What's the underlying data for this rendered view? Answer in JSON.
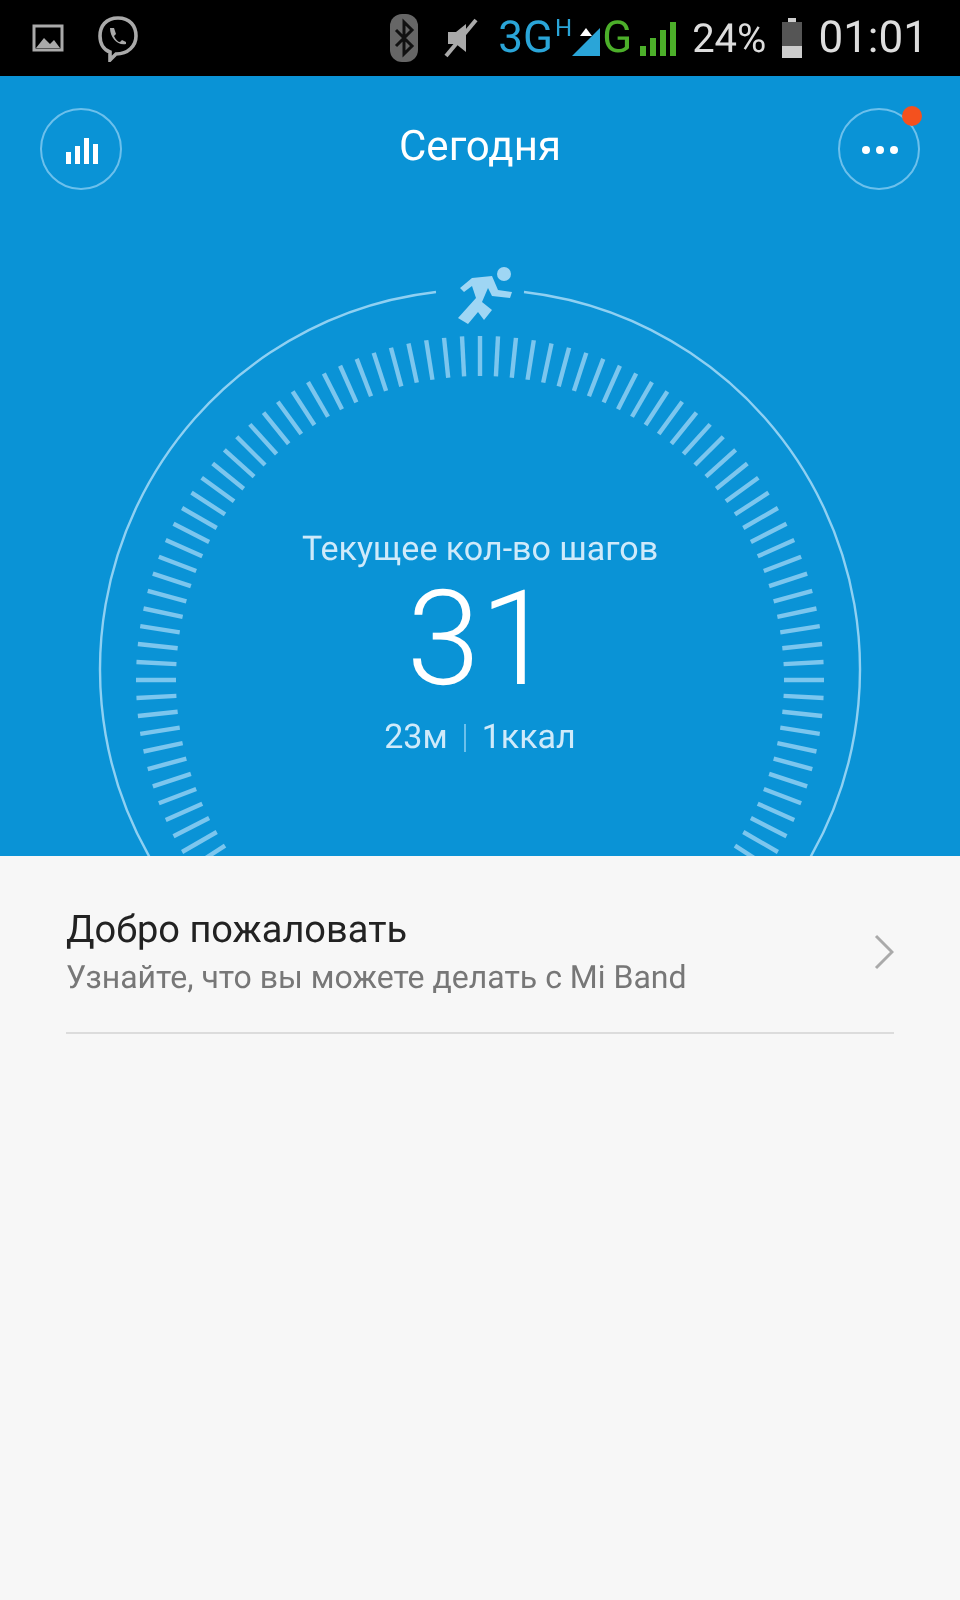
{
  "status_bar": {
    "network": "3G",
    "network_2": "H",
    "network_3": "G",
    "battery": "24%",
    "time": "01:01"
  },
  "header": {
    "title": "Сегодня",
    "menu_has_notification": true
  },
  "steps": {
    "label": "Текущее кол-во шагов",
    "count": "31",
    "distance": "23м",
    "calories": "1ккал"
  },
  "list": [
    {
      "title": "Добро пожаловать",
      "subtitle": "Узнайте, что вы можете делать с Mi Band"
    }
  ]
}
